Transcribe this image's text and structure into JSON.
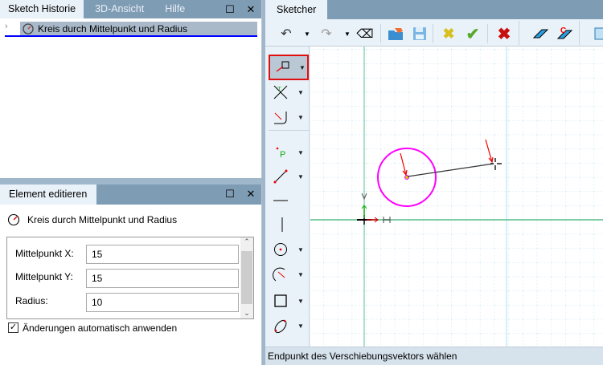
{
  "left_top": {
    "tabs": [
      "Sketch Historie",
      "3D-Ansicht",
      "Hilfe"
    ],
    "tree_item": "Kreis durch Mittelpunkt und Radius"
  },
  "left_bottom": {
    "tab": "Element editieren",
    "element_title": "Kreis durch Mittelpunkt und Radius",
    "fields": [
      {
        "label": "Mittelpunkt X:",
        "value": "15"
      },
      {
        "label": "Mittelpunkt Y:",
        "value": "15"
      },
      {
        "label": "Radius:",
        "value": "10"
      }
    ],
    "auto_apply_label": "Änderungen automatisch anwenden",
    "auto_apply_checked": true
  },
  "sketcher": {
    "tab": "Sketcher",
    "status": "Endpunkt des Verschiebungsvektors wählen"
  },
  "colors": {
    "accent_blue": "#0000ff",
    "highlight": "#a9b9c9",
    "circle": "#ff00ff",
    "axis": "#7fcca6",
    "tab_bar": "#7f9cb5"
  }
}
